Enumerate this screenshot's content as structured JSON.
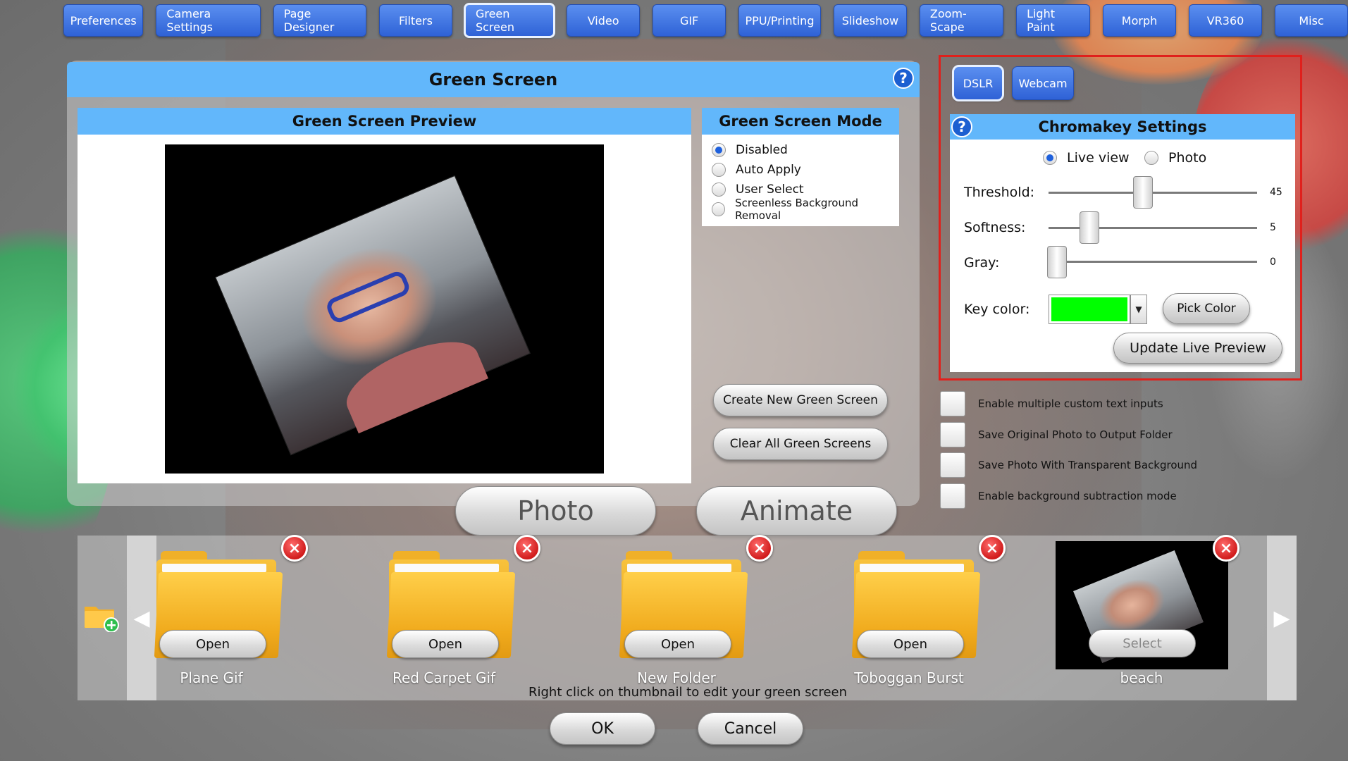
{
  "tabs": [
    {
      "label": "Preferences",
      "active": false
    },
    {
      "label": "Camera Settings",
      "active": false
    },
    {
      "label": "Page Designer",
      "active": false
    },
    {
      "label": "Filters",
      "active": false
    },
    {
      "label": "Green Screen",
      "active": true
    },
    {
      "label": "Video",
      "active": false
    },
    {
      "label": "GIF",
      "active": false
    },
    {
      "label": "PPU/Printing",
      "active": false
    },
    {
      "label": "Slideshow",
      "active": false
    },
    {
      "label": "Zoom-Scape",
      "active": false
    },
    {
      "label": "Light Paint",
      "active": false
    },
    {
      "label": "Morph",
      "active": false
    },
    {
      "label": "VR360",
      "active": false
    },
    {
      "label": "Misc",
      "active": false
    }
  ],
  "panel": {
    "title": "Green Screen",
    "help": "?"
  },
  "preview": {
    "title": "Green Screen Preview"
  },
  "mode": {
    "title": "Green Screen Mode",
    "options": [
      {
        "label": "Disabled",
        "selected": true
      },
      {
        "label": "Auto Apply",
        "selected": false
      },
      {
        "label": "User Select",
        "selected": false
      },
      {
        "label": "Screenless Background Removal",
        "selected": false
      }
    ]
  },
  "actions": {
    "create": "Create New Green Screen",
    "clear": "Clear All Green Screens",
    "photo": "Photo",
    "animate": "Animate"
  },
  "source": {
    "dslr": "DSLR",
    "webcam": "Webcam",
    "active": "DSLR"
  },
  "chroma": {
    "title": "Chromakey Settings",
    "help": "?",
    "view_options": [
      {
        "label": "Live view",
        "selected": true
      },
      {
        "label": "Photo",
        "selected": false
      }
    ],
    "threshold": {
      "label": "Threshold:",
      "value": "45"
    },
    "softness": {
      "label": "Softness:",
      "value": "5"
    },
    "gray": {
      "label": "Gray:",
      "value": "0"
    },
    "key_color": {
      "label": "Key color:",
      "color": "#00ff00",
      "dropdown_icon": "chevron-down-icon"
    },
    "pick_color": "Pick Color",
    "update": "Update Live Preview"
  },
  "checkboxes": [
    {
      "label": "Enable multiple custom text inputs",
      "checked": false
    },
    {
      "label": "Save Original Photo to Output Folder",
      "checked": false
    },
    {
      "label": "Save Photo With Transparent Background",
      "checked": false
    },
    {
      "label": "Enable background subtraction mode",
      "checked": false
    }
  ],
  "strip": {
    "items": [
      {
        "label": "Plane Gif",
        "button": "Open",
        "type": "folder"
      },
      {
        "label": "Red Carpet Gif",
        "button": "Open",
        "type": "folder"
      },
      {
        "label": "New Folder",
        "button": "Open",
        "type": "folder"
      },
      {
        "label": "Toboggan Burst",
        "button": "Open",
        "type": "folder"
      },
      {
        "label": "beach",
        "button": "Select",
        "type": "image"
      }
    ],
    "hint": "Right click on thumbnail to edit your green screen",
    "prev_icon": "arrow-left-icon",
    "next_icon": "arrow-right-icon",
    "add_icon": "add-folder-icon",
    "remove_icon": "close-icon"
  },
  "footer": {
    "ok": "OK",
    "cancel": "Cancel"
  },
  "colors": {
    "tab_blue": "#2f62d6",
    "header_blue": "#62b7fb",
    "highlight_red": "#e0201c",
    "key_green": "#00ff00"
  }
}
